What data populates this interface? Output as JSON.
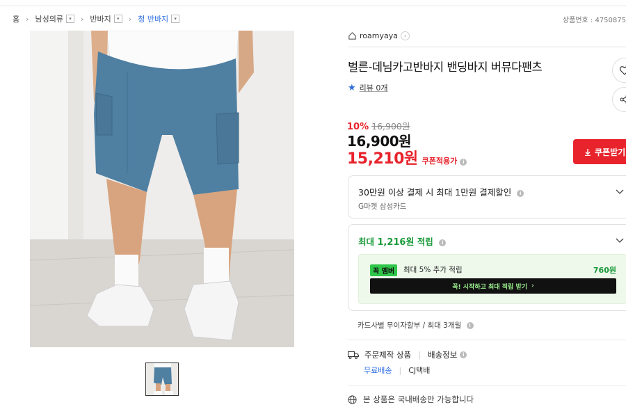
{
  "breadcrumb": {
    "home": "홈",
    "level1": "남성의류",
    "level2": "반바지",
    "current": "청 반바지"
  },
  "product_number_label": "상품번호 : 4750875",
  "seller": {
    "name": "roamyaya"
  },
  "product": {
    "title": "벌른-데님카고반바지 밴딩바지 버뮤다팬츠",
    "review_label": "리뷰 0개"
  },
  "price": {
    "discount_rate": "10%",
    "original": "16,900원",
    "current": "16,900원",
    "coupon_price": "15,210원",
    "coupon_tag": "쿠폰적용가",
    "coupon_button": "쿠폰받기"
  },
  "card_discount": {
    "title": "30만원 이상 결제 시 최대 1만원 결제할인",
    "subtitle": "G마켓 삼성카드"
  },
  "reward": {
    "prefix": "최대 ",
    "amount": "1,216원",
    "suffix": " 적립",
    "club_badge": "멤버",
    "club_text": "최대 5% 추가 적립",
    "club_amount": "760원",
    "club_button": "꼭! 시작하고 최대 적립 받기"
  },
  "installment": "카드사별 무이자할부 / 최대 3개월",
  "shipping": {
    "type": "주문제작 상품",
    "info_label": "배송정보",
    "fee": "무료배송",
    "carrier": "CJ택배"
  },
  "domestic_notice": "본 상품은 국내배송만 가능합니다",
  "colors": {
    "accent_red": "#e8232c",
    "link_blue": "#2f6fe0",
    "reward_green": "#1a9a3a"
  }
}
